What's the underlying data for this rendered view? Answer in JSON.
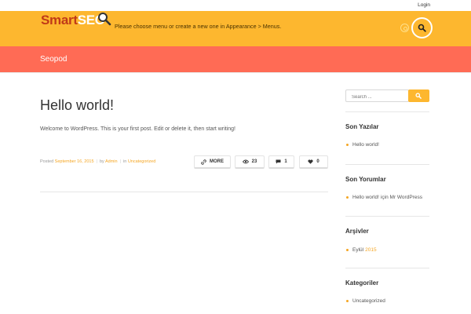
{
  "topbar": {
    "login_label": "Login"
  },
  "header": {
    "logo_smart": "Smart",
    "logo_seo": "SEO",
    "menu_notice": "Please choose menu or create a new one in Appearance > Menus.",
    "colors": {
      "header_bg": "#fdb72f",
      "banner_bg": "#ff6b55",
      "accent": "#f5a623"
    }
  },
  "banner": {
    "title": "Seopod"
  },
  "post": {
    "title": "Hello world!",
    "body": "Welcome to WordPress. This is your first post. Edit or delete it, then start writing!",
    "posted_label": "Posted",
    "date": "September 16, 2015",
    "by_label": "by",
    "author": "Admin",
    "in_label": "in",
    "category": "Uncategorized",
    "more_label": "MORE",
    "views": "23",
    "comments": "1",
    "likes": "0"
  },
  "sidebar": {
    "search_placeholder": "Search ...",
    "recent_posts": {
      "heading": "Son Yazılar",
      "items": [
        "Hello world!"
      ]
    },
    "recent_comments": {
      "heading": "Son Yorumlar",
      "item_post": "Hello world!",
      "item_suffix": "için Mr WordPress"
    },
    "archives": {
      "heading": "Arşivler",
      "month": "Eylül",
      "year": "2015"
    },
    "categories": {
      "heading": "Kategoriler",
      "items": [
        "Uncategorized"
      ]
    }
  },
  "icons": [
    "search-icon",
    "magnifier-logo-icon",
    "link-icon",
    "eye-icon",
    "comment-icon",
    "heart-icon",
    "circle-icon"
  ]
}
